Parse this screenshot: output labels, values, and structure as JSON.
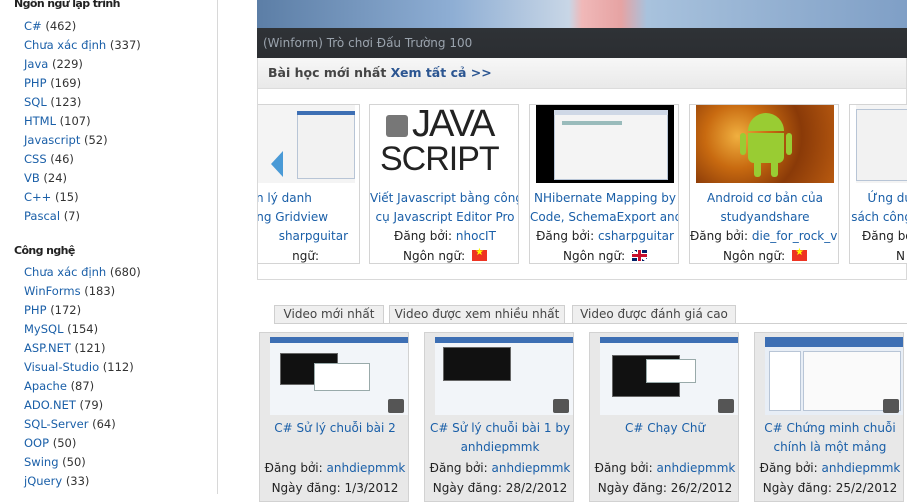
{
  "sidebar": {
    "languages_title": "Ngôn ngữ lập trình",
    "languages": [
      {
        "label": "C#",
        "count": "(462)"
      },
      {
        "label": "Chưa xác định",
        "count": "(337)"
      },
      {
        "label": "Java",
        "count": "(229)"
      },
      {
        "label": "PHP",
        "count": "(169)"
      },
      {
        "label": "SQL",
        "count": "(123)"
      },
      {
        "label": "HTML",
        "count": "(107)"
      },
      {
        "label": "Javascript",
        "count": "(52)"
      },
      {
        "label": "CSS",
        "count": "(46)"
      },
      {
        "label": "VB",
        "count": "(24)"
      },
      {
        "label": "C++",
        "count": "(15)"
      },
      {
        "label": "Pascal",
        "count": "(7)"
      }
    ],
    "tech_title": "Công nghệ",
    "tech": [
      {
        "label": "Chưa xác định",
        "count": "(680)"
      },
      {
        "label": "WinForms",
        "count": "(183)"
      },
      {
        "label": "PHP",
        "count": "(172)"
      },
      {
        "label": "MySQL",
        "count": "(154)"
      },
      {
        "label": "ASP.NET",
        "count": "(121)"
      },
      {
        "label": "Visual-Studio",
        "count": "(112)"
      },
      {
        "label": "Apache",
        "count": "(87)"
      },
      {
        "label": "ADO.NET",
        "count": "(79)"
      },
      {
        "label": "SQL-Server",
        "count": "(64)"
      },
      {
        "label": "OOP",
        "count": "(50)"
      },
      {
        "label": "Swing",
        "count": "(50)"
      },
      {
        "label": "jQuery",
        "count": "(33)"
      }
    ]
  },
  "banner": {
    "caption": "(Winform) Trò chơi Đấu Trường 100"
  },
  "lessons": {
    "heading": "Bài học mới nhất",
    "view_all": "Xem tất cả >>",
    "by_label": "Đăng bởi:",
    "lang_label": "Ngôn ngữ:",
    "cards": [
      {
        "title_lines": [
          "uản lý danh",
          "dùng Gridview"
        ],
        "author": "sharpguitar",
        "flag": "",
        "partial": "left"
      },
      {
        "title_lines": [
          "Viết Javascript bằng công",
          "cụ Javascript Editor Pro"
        ],
        "author": "nhocIT",
        "flag": "vn",
        "thumb": "javascript"
      },
      {
        "title_lines": [
          "NHibernate Mapping by",
          "Code, SchemaExport and"
        ],
        "author": "csharpguitar",
        "flag": "uk",
        "thumb": "screen"
      },
      {
        "title_lines": [
          "Android cơ bản của",
          "studyandshare"
        ],
        "author": "die_for_rock_vn",
        "flag": "vn",
        "thumb": "android"
      },
      {
        "title_lines": [
          "Ứng dụ",
          "sách công"
        ],
        "author": "",
        "flag": "",
        "partial": "right"
      }
    ],
    "javascript_logo": [
      "JAVA",
      "SCRIPT"
    ]
  },
  "tabs": [
    "Video mới nhất",
    "Video được xem nhiều nhất",
    "Video được đánh giá cao"
  ],
  "videos": {
    "by_label": "Đăng bởi:",
    "date_label": "Ngày đăng:",
    "items": [
      {
        "title_lines": [
          "C# Sử lý chuỗi bài 2"
        ],
        "author": "anhdiepmmk",
        "date": "1/3/2012"
      },
      {
        "title_lines": [
          "C# Sử lý chuỗi bài 1 by",
          "anhdiepmmk"
        ],
        "author": "anhdiepmmk",
        "date": "28/2/2012"
      },
      {
        "title_lines": [
          "C# Chạy Chữ"
        ],
        "author": "anhdiepmmk",
        "date": "26/2/2012"
      },
      {
        "title_lines": [
          "C# Chứng minh chuỗi",
          "chính là một mảng"
        ],
        "author": "anhdiepmmk",
        "date": "25/2/2012"
      }
    ]
  }
}
